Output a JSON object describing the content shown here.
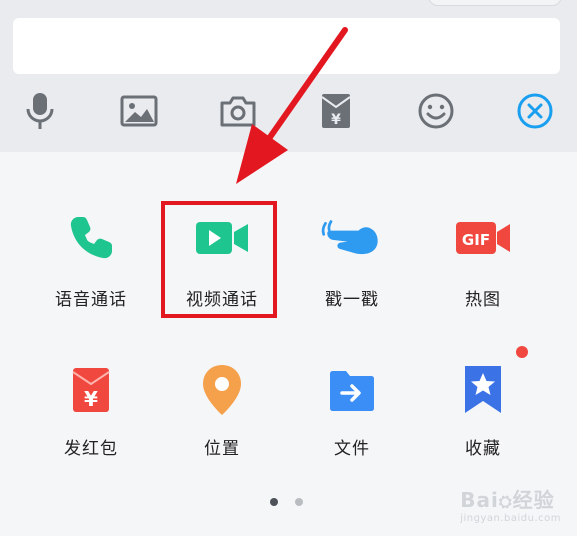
{
  "panel": {
    "items": [
      {
        "label": "语音通话",
        "icon": "phone-icon"
      },
      {
        "label": "视频通话",
        "icon": "video-camera-icon"
      },
      {
        "label": "戳一戳",
        "icon": "poke-hand-icon"
      },
      {
        "label": "热图",
        "icon": "gif-icon",
        "icon_text": "GIF"
      },
      {
        "label": "发红包",
        "icon": "red-packet-icon",
        "icon_text": "¥"
      },
      {
        "label": "位置",
        "icon": "location-pin-icon"
      },
      {
        "label": "文件",
        "icon": "folder-icon"
      },
      {
        "label": "收藏",
        "icon": "bookmark-star-icon"
      }
    ],
    "page_indicator": {
      "current": 1,
      "total": 2
    }
  },
  "toolbar": {
    "icons": [
      "microphone-icon",
      "image-icon",
      "camera-icon",
      "red-packet-icon",
      "emoji-icon",
      "close-circle-icon"
    ],
    "red_packet_text": "¥"
  },
  "watermark": {
    "main": "Bai",
    "main2": "经验",
    "sub": "jingyan.baidu.com"
  },
  "colors": {
    "phone": "#1fc58f",
    "video": "#1fc58f",
    "poke": "#2f9bf0",
    "gif": "#f0473e",
    "red_packet": "#f0473e",
    "location": "#f5a04b",
    "folder": "#3b8ef5",
    "bookmark": "#3b72e6",
    "highlight": "#e3171f",
    "close": "#1a9ff0"
  }
}
